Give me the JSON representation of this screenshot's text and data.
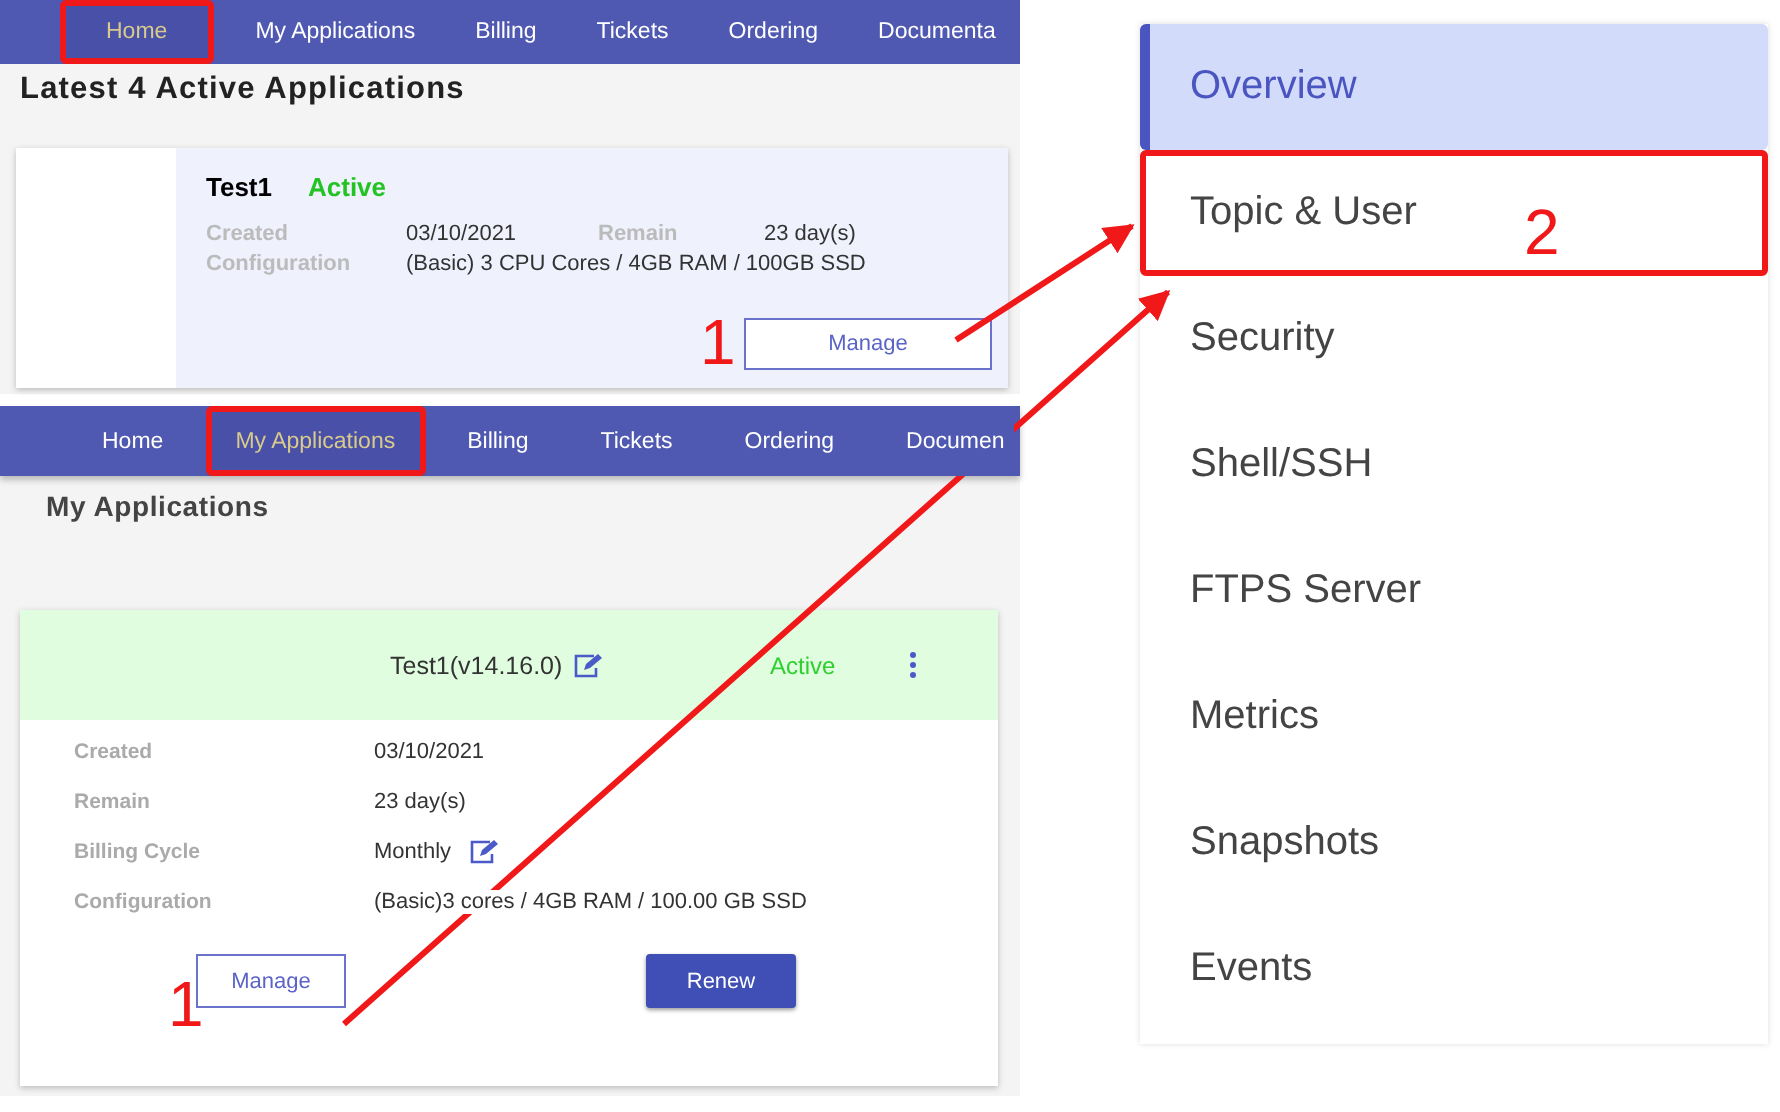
{
  "home_panel": {
    "nav": [
      {
        "label": "Home",
        "selected": true,
        "highlighted": true
      },
      {
        "label": "My Applications",
        "selected": false,
        "highlighted": false
      },
      {
        "label": "Billing",
        "selected": false,
        "highlighted": false
      },
      {
        "label": "Tickets",
        "selected": false,
        "highlighted": false
      },
      {
        "label": "Ordering",
        "selected": false,
        "highlighted": false
      },
      {
        "label": "Documenta",
        "selected": false,
        "highlighted": false
      }
    ],
    "heading": "Latest 4 Active Applications",
    "card": {
      "name": "Test1",
      "status": "Active",
      "rows": [
        [
          {
            "label": "Created",
            "value": "03/10/2021"
          },
          {
            "label": "Remain",
            "value": "23 day(s)"
          }
        ],
        [
          {
            "label": "Configuration",
            "value": "(Basic) 3 CPU Cores / 4GB RAM / 100GB SSD"
          }
        ]
      ],
      "button": "Manage"
    }
  },
  "applications_panel": {
    "nav": [
      {
        "label": "Home",
        "selected": false,
        "highlighted": false
      },
      {
        "label": "My Applications",
        "selected": true,
        "highlighted": true
      },
      {
        "label": "Billing",
        "selected": false,
        "highlighted": false
      },
      {
        "label": "Tickets",
        "selected": false,
        "highlighted": false
      },
      {
        "label": "Ordering",
        "selected": false,
        "highlighted": false
      },
      {
        "label": "Documen",
        "selected": false,
        "highlighted": false
      }
    ],
    "heading": "My Applications",
    "card": {
      "title": "Test1(v14.16.0)",
      "status": "Active",
      "fields": [
        {
          "label": "Created",
          "value": "03/10/2021",
          "editable": false
        },
        {
          "label": "Remain",
          "value": "23 day(s)",
          "editable": false
        },
        {
          "label": "Billing Cycle",
          "value": "Monthly",
          "editable": true
        },
        {
          "label": "Configuration",
          "value": "(Basic)3 cores / 4GB RAM / 100.00 GB SSD",
          "editable": false
        }
      ],
      "buttons": [
        {
          "label": "Manage",
          "kind": "outline"
        },
        {
          "label": "Renew",
          "kind": "filled"
        }
      ]
    }
  },
  "sidebar": {
    "items": [
      {
        "label": "Overview",
        "selected": true,
        "highlighted": false
      },
      {
        "label": "Topic & User",
        "selected": false,
        "highlighted": true
      },
      {
        "label": "Security",
        "selected": false,
        "highlighted": false
      },
      {
        "label": "Shell/SSH",
        "selected": false,
        "highlighted": false
      },
      {
        "label": "FTPS Server",
        "selected": false,
        "highlighted": false
      },
      {
        "label": "Metrics",
        "selected": false,
        "highlighted": false
      },
      {
        "label": "Snapshots",
        "selected": false,
        "highlighted": false
      },
      {
        "label": "Events",
        "selected": false,
        "highlighted": false
      }
    ]
  },
  "annotations": [
    "1",
    "1",
    "2"
  ]
}
